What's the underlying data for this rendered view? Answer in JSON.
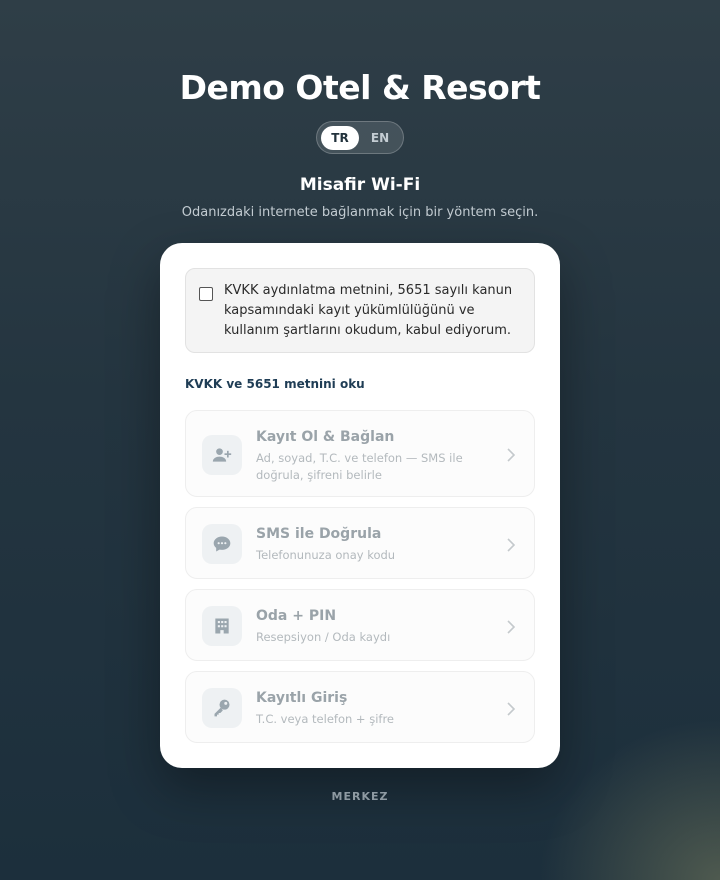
{
  "header": {
    "brand": "Demo Otel & Resort",
    "languages": {
      "tr": "TR",
      "en": "EN",
      "selected": "TR"
    },
    "title": "Misafir Wi-Fi",
    "subtitle": "Odanızdaki internete bağlanmak için bir yöntem seçin."
  },
  "consent": {
    "text": "KVKK aydınlatma metnini, 5651 sayılı kanun kapsamındaki kayıt yükümlülüğünü ve kullanım şartlarını okudum, kabul ediyorum.",
    "checked": false,
    "read_link": "KVKK ve 5651 metnini oku"
  },
  "options": [
    {
      "icon": "person-add-icon",
      "title": "Kayıt Ol & Bağlan",
      "description": "Ad, soyad, T.C. ve telefon — SMS ile doğrula, şifreni belirle"
    },
    {
      "icon": "chat-bubble-icon",
      "title": "SMS ile Doğrula",
      "description": "Telefonunuza onay kodu"
    },
    {
      "icon": "building-icon",
      "title": "Oda + PIN",
      "description": "Resepsiyon / Oda kaydı"
    },
    {
      "icon": "key-icon",
      "title": "Kayıtlı Giriş",
      "description": "T.C. veya telefon + şifre"
    }
  ],
  "footer": {
    "label": "MERKEZ"
  },
  "colors": {
    "background": "#243540",
    "card": "#ffffff",
    "accent": "#1f3d55"
  }
}
